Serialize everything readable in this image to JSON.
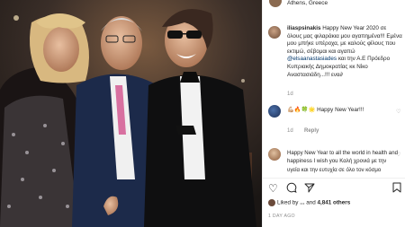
{
  "location": "Athens, Greece",
  "caption": {
    "username": "iliaspsinakis",
    "text_1": "Happy New Year 2020 σε όλους μας φιλαράκια μου αγαπημένα!!! Εμένα μου μπήκε υπέροχα, με καλούς φίλους που εκτιμώ, σέβομαι και αγαπώ",
    "mention_1": "@elsaanastasiades",
    "text_2": "και την Α.Ε Πρόεδρο Κυπριακής Δημοκρατίας κκ Νίκο Αναστασιάδη...!!! ενα∂"
  },
  "caption_meta": {
    "age": "1d"
  },
  "comment_1": {
    "emojis": "💪🏼🔥🍀🌟",
    "text": "Happy New Year!!!",
    "age": "1d",
    "reply_label": "Reply"
  },
  "comment_2": {
    "text": "Happy New Year to all the world in health and happiness I wish you Καλή χρονιά με την υγεία και την ευτυχία σε όλο τον κόσμο"
  },
  "actions": {
    "like_icon": "heart-icon",
    "comment_icon": "comment-icon",
    "share_icon": "share-icon",
    "save_icon": "bookmark-icon"
  },
  "likes": {
    "liked_by_prefix": "Liked by",
    "liked_by_user": "...",
    "and": "and",
    "others_count": "4,841 others"
  },
  "date": "1 DAY AGO"
}
